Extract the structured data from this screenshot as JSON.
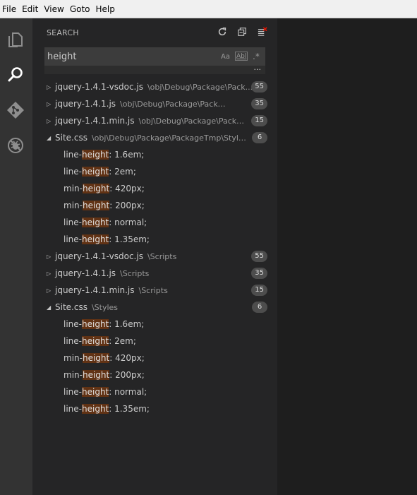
{
  "menu": [
    "File",
    "Edit",
    "View",
    "Goto",
    "Help"
  ],
  "activity": [
    "files-icon",
    "search-icon",
    "git-icon",
    "debug-icon"
  ],
  "sidebar": {
    "title": "SEARCH",
    "actions": [
      "refresh-icon",
      "collapse-all-icon",
      "clear-results-icon"
    ]
  },
  "search": {
    "value": "height",
    "opt_case": "Aa",
    "opt_word": "Abl",
    "opt_regex": ".*",
    "more": "..."
  },
  "results": [
    {
      "name": "jquery-1.4.1-vsdoc.js",
      "path": "\\obj\\Debug\\Package\\Pack...",
      "count": "55",
      "expanded": false,
      "matches": []
    },
    {
      "name": "jquery-1.4.1.js",
      "path": "\\obj\\Debug\\Package\\PackageTmp...",
      "count": "35",
      "expanded": false,
      "matches": []
    },
    {
      "name": "jquery-1.4.1.min.js",
      "path": "\\obj\\Debug\\Package\\Packag...",
      "count": "15",
      "expanded": false,
      "matches": []
    },
    {
      "name": "Site.css",
      "path": "\\obj\\Debug\\Package\\PackageTmp\\Styles",
      "count": "6",
      "expanded": true,
      "matches": [
        {
          "pre": "line-",
          "hit": "height",
          "post": ": 1.6em;"
        },
        {
          "pre": "line-",
          "hit": "height",
          "post": ": 2em;"
        },
        {
          "pre": "min-",
          "hit": "height",
          "post": ": 420px;"
        },
        {
          "pre": "min-",
          "hit": "height",
          "post": ": 200px;"
        },
        {
          "pre": "line-",
          "hit": "height",
          "post": ": normal;"
        },
        {
          "pre": "line-",
          "hit": "height",
          "post": ": 1.35em;"
        }
      ]
    },
    {
      "name": "jquery-1.4.1-vsdoc.js",
      "path": "\\Scripts",
      "count": "55",
      "expanded": false,
      "matches": []
    },
    {
      "name": "jquery-1.4.1.js",
      "path": "\\Scripts",
      "count": "35",
      "expanded": false,
      "matches": []
    },
    {
      "name": "jquery-1.4.1.min.js",
      "path": "\\Scripts",
      "count": "15",
      "expanded": false,
      "matches": []
    },
    {
      "name": "Site.css",
      "path": "\\Styles",
      "count": "6",
      "expanded": true,
      "matches": [
        {
          "pre": "line-",
          "hit": "height",
          "post": ": 1.6em;"
        },
        {
          "pre": "line-",
          "hit": "height",
          "post": ": 2em;"
        },
        {
          "pre": "min-",
          "hit": "height",
          "post": ": 420px;"
        },
        {
          "pre": "min-",
          "hit": "height",
          "post": ": 200px;"
        },
        {
          "pre": "line-",
          "hit": "height",
          "post": ": normal;"
        },
        {
          "pre": "line-",
          "hit": "height",
          "post": ": 1.35em;"
        }
      ]
    }
  ],
  "colors": {
    "highlight": "#613214",
    "badge": "#4d4d4d"
  }
}
